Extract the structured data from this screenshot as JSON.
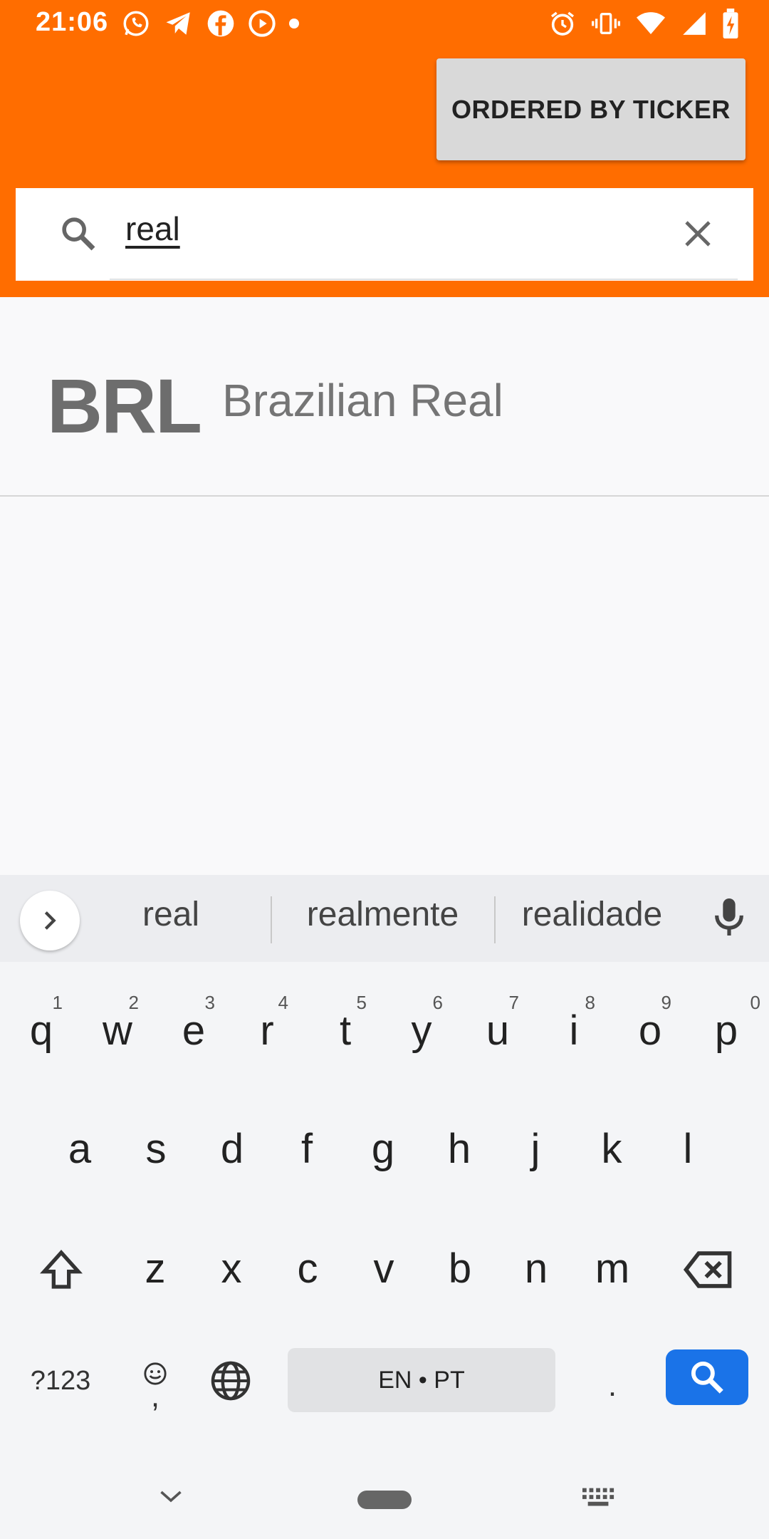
{
  "status_bar": {
    "time": "21:06",
    "left_icons": [
      "whatsapp-icon",
      "telegram-icon",
      "facebook-icon",
      "youtube-icon",
      "dot-icon"
    ],
    "right_icons": [
      "alarm-icon",
      "vibrate-icon",
      "wifi-icon",
      "signal-icon",
      "battery-icon"
    ]
  },
  "colors": {
    "app_bar": "#ff6d00",
    "search_key": "#1a73e8"
  },
  "toolbar": {
    "sort_label": "ORDERED BY TICKER"
  },
  "search": {
    "query": "real",
    "icon": "search-icon",
    "clear_icon": "close-icon"
  },
  "results": [
    {
      "ticker": "BRL",
      "name": "Brazilian Real"
    }
  ],
  "keyboard": {
    "suggestions": [
      "real",
      "realmente",
      "realidade"
    ],
    "row1": [
      {
        "k": "q",
        "h": "1"
      },
      {
        "k": "w",
        "h": "2"
      },
      {
        "k": "e",
        "h": "3"
      },
      {
        "k": "r",
        "h": "4"
      },
      {
        "k": "t",
        "h": "5"
      },
      {
        "k": "y",
        "h": "6"
      },
      {
        "k": "u",
        "h": "7"
      },
      {
        "k": "i",
        "h": "8"
      },
      {
        "k": "o",
        "h": "9"
      },
      {
        "k": "p",
        "h": "0"
      }
    ],
    "row2": [
      "a",
      "s",
      "d",
      "f",
      "g",
      "h",
      "j",
      "k",
      "l"
    ],
    "row3": [
      "z",
      "x",
      "c",
      "v",
      "b",
      "n",
      "m"
    ],
    "symbols_label": "?123",
    "comma_label": ",",
    "space_label": "EN • PT",
    "period_label": "."
  }
}
